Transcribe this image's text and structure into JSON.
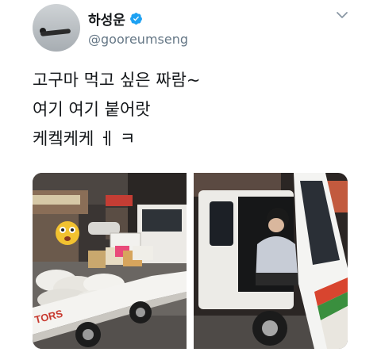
{
  "user": {
    "display_name": "하성운",
    "handle": "@gooreumseng",
    "verified": true
  },
  "tweet": {
    "line1": "고구마 먹고 싶은 짜람~",
    "line2": "여기 여기 붙어랏",
    "line3": "케켘케케 ㅔ ㅋ"
  },
  "photo1": {
    "truck_brand": "TORS"
  },
  "icons": [
    "verified-badge-icon",
    "chevron-down-icon"
  ],
  "colors": {
    "verified": "#1da1f2",
    "handle": "#657786",
    "text": "#14171a"
  }
}
